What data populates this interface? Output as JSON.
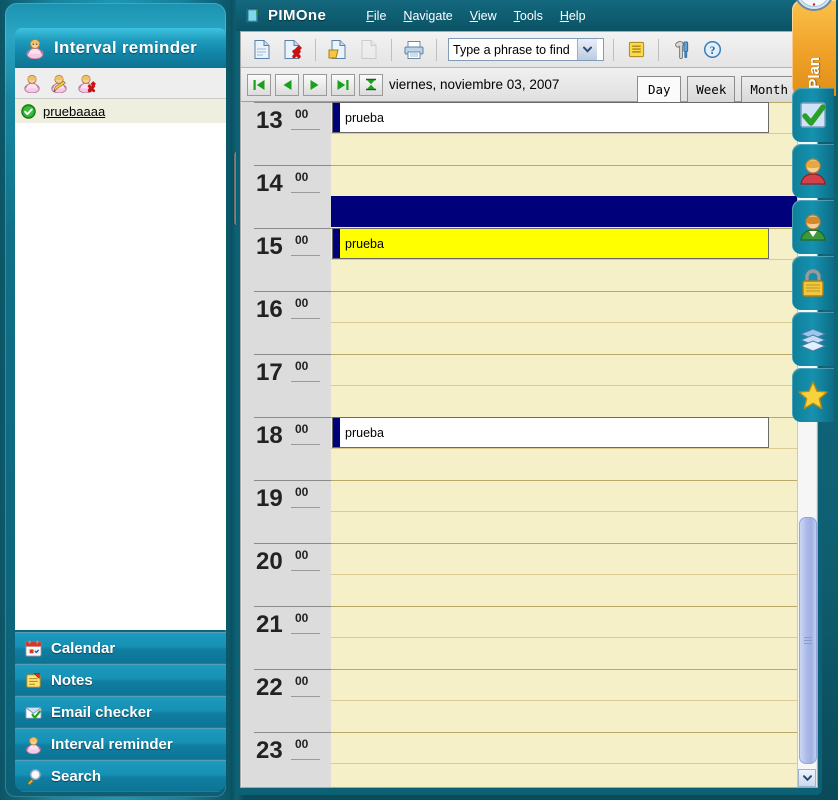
{
  "app": {
    "title": "PIMOne",
    "app_icon": "notebook-icon"
  },
  "menubar": {
    "items": [
      {
        "label": "File",
        "accel": "F"
      },
      {
        "label": "Navigate",
        "accel": "N"
      },
      {
        "label": "View",
        "accel": "V"
      },
      {
        "label": "Tools",
        "accel": "T"
      },
      {
        "label": "Help",
        "accel": "H"
      }
    ]
  },
  "toolbar": {
    "buttons": [
      {
        "name": "new-document-icon",
        "label": "New"
      },
      {
        "name": "delete-document-icon",
        "label": "Delete"
      },
      {
        "name": "open-document-icon",
        "label": "Open"
      },
      {
        "name": "copy-document-icon",
        "label": "Copy",
        "disabled": true
      },
      {
        "name": "print-icon",
        "label": "Print"
      },
      {
        "name": "notes-icon",
        "label": "Notes"
      },
      {
        "name": "tools-icon",
        "label": "Tools"
      },
      {
        "name": "help-icon",
        "label": "Help"
      }
    ],
    "search": {
      "value": "Type a phrase to find",
      "placeholder": "Type a phrase to find",
      "dropdown_icon": "chevron-down-icon"
    }
  },
  "calendar": {
    "nav_buttons": [
      {
        "name": "first-day-button",
        "icon": "skip-back-icon"
      },
      {
        "name": "previous-day-button",
        "icon": "triangle-left-icon"
      },
      {
        "name": "next-day-button",
        "icon": "triangle-right-icon"
      },
      {
        "name": "last-day-button",
        "icon": "skip-forward-icon"
      },
      {
        "name": "filter-button",
        "icon": "hourglass-icon"
      }
    ],
    "date_label": "viernes, noviembre 03, 2007",
    "views": [
      {
        "label": "Day",
        "active": true
      },
      {
        "label": "Week",
        "active": false
      },
      {
        "label": "Month",
        "active": false
      }
    ],
    "minute_label": "00",
    "hours": [
      {
        "hour": "13",
        "appointment": {
          "title": "prueba",
          "half": 1,
          "style": "white"
        }
      },
      {
        "hour": "14",
        "band": {
          "half": 2
        }
      },
      {
        "hour": "15",
        "appointment": {
          "title": "prueba",
          "half": 1,
          "style": "yellow"
        }
      },
      {
        "hour": "16"
      },
      {
        "hour": "17"
      },
      {
        "hour": "18",
        "appointment": {
          "title": "prueba",
          "half": 1,
          "style": "white"
        }
      },
      {
        "hour": "19"
      },
      {
        "hour": "20"
      },
      {
        "hour": "21"
      },
      {
        "hour": "22"
      },
      {
        "hour": "23"
      }
    ],
    "scrollbar": {
      "up_icon": "chevron-up-icon",
      "down_icon": "chevron-down-icon"
    }
  },
  "left_panel": {
    "title": "Interval reminder",
    "title_icon": "reminder-person-icon",
    "tool_buttons": [
      {
        "name": "add-reminder-icon",
        "label": "Add"
      },
      {
        "name": "edit-reminder-icon",
        "label": "Edit"
      },
      {
        "name": "delete-reminder-icon",
        "label": "Delete"
      }
    ],
    "list": [
      {
        "label": "pruebaaaa",
        "checked": true,
        "selected": true
      }
    ],
    "nav_items": [
      {
        "label": "Calendar",
        "icon": "calendar-icon"
      },
      {
        "label": "Notes",
        "icon": "notes-icon"
      },
      {
        "label": "Email checker",
        "icon": "email-check-icon"
      },
      {
        "label": "Interval reminder",
        "icon": "reminder-person-icon"
      },
      {
        "label": "Search",
        "icon": "magnifier-icon"
      }
    ]
  },
  "right_dock": {
    "plan": {
      "label": "Plan",
      "icon": "clock-icon"
    },
    "items": [
      {
        "name": "tasks-dock-button",
        "icon": "check-icon"
      },
      {
        "name": "contacts-dock-button",
        "icon": "person-red-icon"
      },
      {
        "name": "people-dock-button",
        "icon": "person-green-icon"
      },
      {
        "name": "password-dock-button",
        "icon": "padlock-icon"
      },
      {
        "name": "notes-dock-button",
        "icon": "pages-icon"
      },
      {
        "name": "favorites-dock-button",
        "icon": "star-icon"
      }
    ]
  },
  "colors": {
    "accent_teal": "#1590ad",
    "appt_bar": "#00007b",
    "appt_highlight": "#ffff00",
    "grid_bg": "#f6f0c9",
    "plan_tab": "#f0a128"
  }
}
